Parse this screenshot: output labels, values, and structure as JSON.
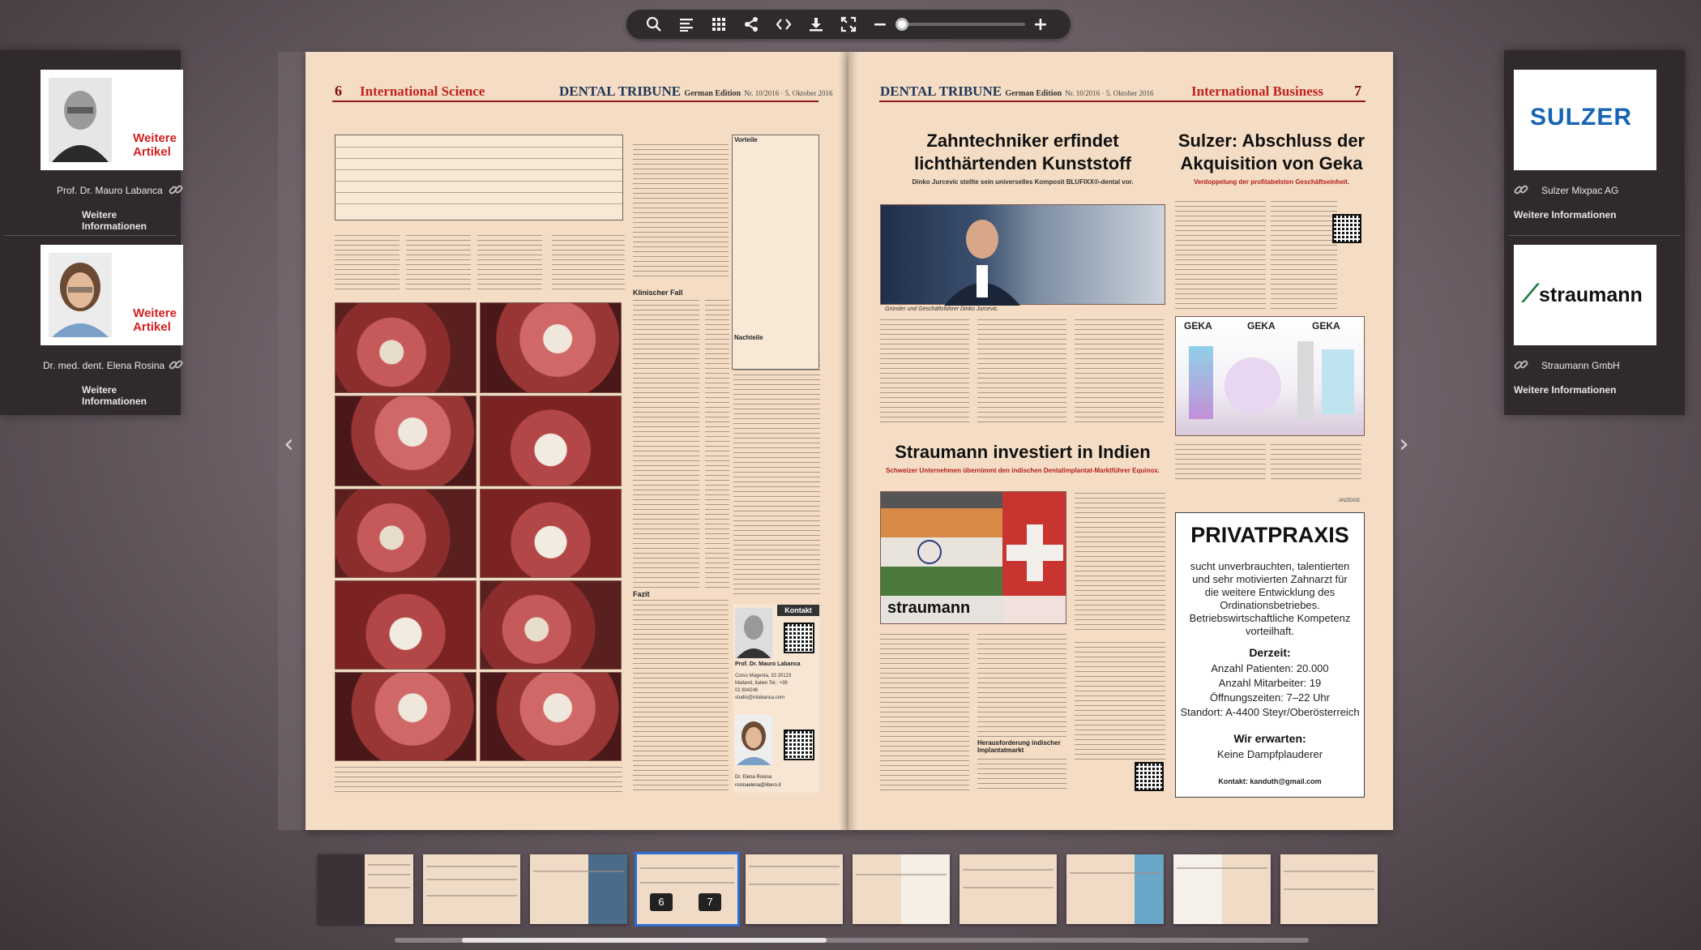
{
  "toolbar": {
    "icons": [
      "search-icon",
      "table-of-contents-icon",
      "grid-icon",
      "share-icon",
      "embed-icon",
      "download-icon",
      "fullscreen-icon"
    ],
    "zoom_minus": "−",
    "zoom_plus": "+",
    "zoom_level": 0
  },
  "left_panel": {
    "authors": [
      {
        "name": "Prof. Dr. Mauro Labanca",
        "badge_line1": "Weitere",
        "badge_line2": "Artikel",
        "more": "Weitere Informationen"
      },
      {
        "name": "Dr. med. dent. Elena Rosina",
        "badge_line1": "Weitere",
        "badge_line2": "Artikel",
        "more": "Weitere Informationen"
      }
    ]
  },
  "right_panel": {
    "companies": [
      {
        "logo": "SULZER",
        "name": "Sulzer Mixpac AG",
        "more": "Weitere Informationen"
      },
      {
        "logo": "straumann",
        "name": "Straumann GmbH",
        "more": "Weitere Informationen"
      }
    ]
  },
  "left_page": {
    "page_number": "6",
    "section": "International Science",
    "masthead": "DENTAL TRIBUNE",
    "edition": "German Edition",
    "issue": "Nr. 10/2016 · 5. Oktober 2016",
    "figure_box": {
      "title": "Klinischer Fall",
      "fazit": "Fazit",
      "vorteile": "Vorteile",
      "nachteile": "Nachteile"
    },
    "contact": {
      "label": "Kontakt",
      "person1": "Prof. Dr. Mauro Labanca",
      "address": "Corso Magenta, 32 20123 Mailand, Italien Tel.: +39 02 804246 studio@mlabanca.com",
      "person2": "Dr. Elena Rosina",
      "email2": "rosinaelena@libero.it"
    }
  },
  "right_page": {
    "page_number": "7",
    "section": "International Business",
    "masthead": "DENTAL TRIBUNE",
    "edition": "German Edition",
    "issue": "Nr. 10/2016 · 5. Oktober 2016",
    "article1": {
      "headline": "Zahntechniker erfindet lichthärtenden Kunststoff",
      "sub": "Dinko Jurcevic stellte sein universelles Komposit BLUFIXX®-dental vor.",
      "caption": "Gründer und Geschäftsführer Dinko Jurcevic."
    },
    "article2": {
      "headline": "Sulzer: Abschluss der Akquisition von Geka",
      "sub": "Verdoppelung der profitabelsten Geschäftseinheit.",
      "product_label": "GEKA"
    },
    "article3": {
      "headline": "Straumann investiert in Indien",
      "sub": "Schweizer Unternehmen übernimmt den indischen Dentalimplantat-Marktführer Equinox.",
      "logo": "straumann",
      "heading2": "Herausforderung indischer Implantatmarkt"
    },
    "ad": {
      "label": "ANZEIGE",
      "title": "PRIVATPRAXIS",
      "text": "sucht unverbrauchten, talentierten und sehr motivierten Zahnarzt für die weitere Entwicklung des Ordinationsbetriebes. Betriebswirtschaftliche Kompetenz vorteilhaft.",
      "status_head": "Derzeit:",
      "status_lines": [
        "Anzahl Patienten: 20.000",
        "Anzahl Mitarbeiter: 19",
        "Öffnungszeiten: 7–22 Uhr",
        "Standort: A-4400 Steyr/Oberösterreich"
      ],
      "expect_head": "Wir erwarten:",
      "expect_line": "Keine Dampfplauderer",
      "contact": "Kontakt: kanduth@gmail.com"
    }
  },
  "thumbnails": {
    "active_pages": [
      "6",
      "7"
    ]
  }
}
